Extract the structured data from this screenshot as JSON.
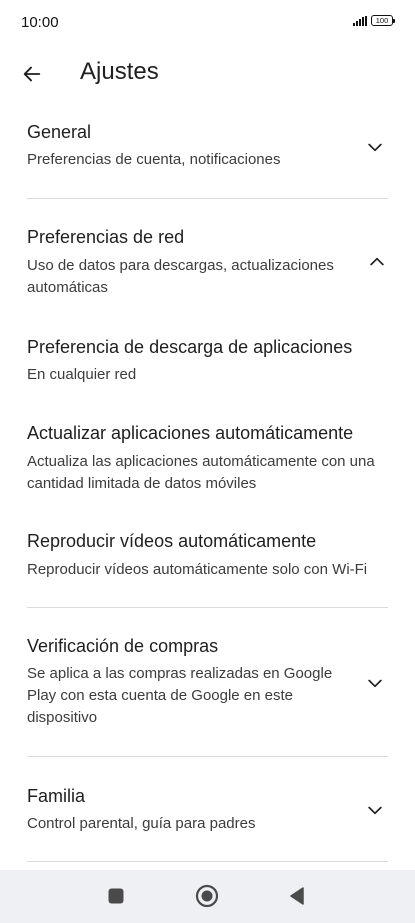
{
  "status_bar": {
    "time": "10:00",
    "battery": "100"
  },
  "header": {
    "title": "Ajustes"
  },
  "settings": {
    "general": {
      "title": "General",
      "subtitle": "Preferencias de cuenta, notificaciones"
    },
    "network": {
      "title": "Preferencias de red",
      "subtitle_line1": "Uso de datos para descargas, actualizaciones",
      "subtitle_line2": "automáticas"
    },
    "download_pref": {
      "title": "Preferencia de descarga de aplicaciones",
      "subtitle": "En cualquier red"
    },
    "auto_update": {
      "title": "Actualizar aplicaciones automáticamente",
      "subtitle_line1": "Actualiza las aplicaciones automáticamente con una",
      "subtitle_line2": "cantidad limitada de datos móviles"
    },
    "autoplay": {
      "title": "Reproducir vídeos automáticamente",
      "subtitle": "Reproducir vídeos automáticamente solo con Wi-Fi"
    },
    "purchase": {
      "title": "Verificación de compras",
      "subtitle_line1": "Se aplica a las compras realizadas en Google",
      "subtitle_line2": "Play con esta cuenta de Google en este",
      "subtitle_line3": "dispositivo"
    },
    "family": {
      "title": "Familia",
      "subtitle": "Control parental, guía para padres"
    }
  },
  "icons": {
    "back": "arrow-left-icon",
    "expand": "chevron-down-icon",
    "collapse": "chevron-up-icon",
    "recents": "square-icon",
    "home": "circle-icon",
    "nav_back": "triangle-left-icon"
  },
  "colors": {
    "text_primary": "#1f1f1f",
    "text_secondary": "#3c3c3c",
    "divider": "#dadada",
    "nav_bar": "#eef0f4"
  }
}
